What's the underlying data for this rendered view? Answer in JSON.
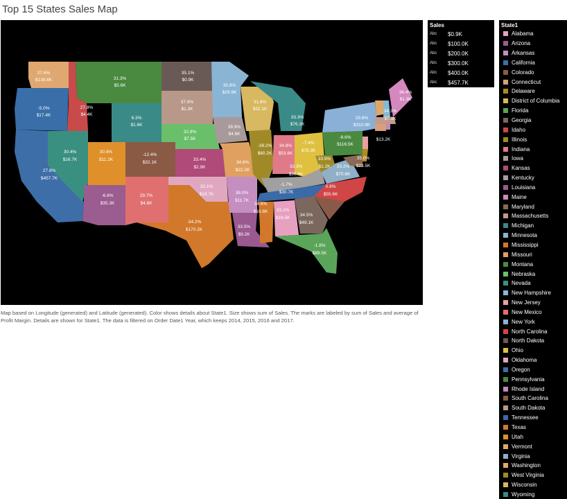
{
  "title": "Top 15 States Sales Map",
  "caption": "Map based on Longitude (generated) and Latitude (generated).  Color shows details about State1.  Size shows sum of Sales.  The marks are labeled by sum of Sales and average of Profit Margin.  Details are shown for State1. The data is filtered on Order Date1 Year, which keeps 2014, 2015, 2016 and 2017.",
  "sales_legend": {
    "header": "Sales",
    "items": [
      "$0.9K",
      "$100.0K",
      "$200.0K",
      "$300.0K",
      "$400.0K",
      "$457.7K"
    ],
    "icon_text": "Abc"
  },
  "state_legend": {
    "header": "State1",
    "items": [
      {
        "name": "Alabama",
        "color": "#e8a0c0"
      },
      {
        "name": "Arizona",
        "color": "#9b5c8f"
      },
      {
        "name": "Arkansas",
        "color": "#c48ec1"
      },
      {
        "name": "California",
        "color": "#3e6ea8"
      },
      {
        "name": "Colorado",
        "color": "#8a5a45"
      },
      {
        "name": "Connecticut",
        "color": "#d6a07a"
      },
      {
        "name": "Delaware",
        "color": "#b08a20"
      },
      {
        "name": "District of Columbia",
        "color": "#d7b75a"
      },
      {
        "name": "Florida",
        "color": "#5ba55a"
      },
      {
        "name": "Georgia",
        "color": "#7b675d"
      },
      {
        "name": "Idaho",
        "color": "#c84a4a"
      },
      {
        "name": "Illinois",
        "color": "#a08a2a"
      },
      {
        "name": "Indiana",
        "color": "#e07a88"
      },
      {
        "name": "Iowa",
        "color": "#a89a9a"
      },
      {
        "name": "Kansas",
        "color": "#b04a78"
      },
      {
        "name": "Kentucky",
        "color": "#a0a0a0"
      },
      {
        "name": "Louisiana",
        "color": "#9a5a90"
      },
      {
        "name": "Maine",
        "color": "#d488be"
      },
      {
        "name": "Maryland",
        "color": "#8a6a55"
      },
      {
        "name": "Massachusetts",
        "color": "#c49a8a"
      },
      {
        "name": "Michigan",
        "color": "#3a8a88"
      },
      {
        "name": "Minnesota",
        "color": "#8ab4d4"
      },
      {
        "name": "Mississippi",
        "color": "#d2782a"
      },
      {
        "name": "Missouri",
        "color": "#e0a060"
      },
      {
        "name": "Montana",
        "color": "#4a8a40"
      },
      {
        "name": "Nebraska",
        "color": "#6abf6a"
      },
      {
        "name": "Nevada",
        "color": "#3a9080"
      },
      {
        "name": "New Hampshire",
        "color": "#88b8d8"
      },
      {
        "name": "New Jersey",
        "color": "#e8a0a0"
      },
      {
        "name": "New Mexico",
        "color": "#e07070"
      },
      {
        "name": "New York",
        "color": "#8ab0d8"
      },
      {
        "name": "North Carolina",
        "color": "#d04545"
      },
      {
        "name": "North Dakota",
        "color": "#6a5a55"
      },
      {
        "name": "Ohio",
        "color": "#e0c040"
      },
      {
        "name": "Oklahoma",
        "color": "#e0a8c0"
      },
      {
        "name": "Oregon",
        "color": "#3a6ea8"
      },
      {
        "name": "Pennsylvania",
        "color": "#4a8a40"
      },
      {
        "name": "Rhode Island",
        "color": "#c08ac0"
      },
      {
        "name": "South Carolina",
        "color": "#8a5a48"
      },
      {
        "name": "South Dakota",
        "color": "#b89888"
      },
      {
        "name": "Tennessee",
        "color": "#3a6aa8"
      },
      {
        "name": "Texas",
        "color": "#d2782a"
      },
      {
        "name": "Utah",
        "color": "#e0902a"
      },
      {
        "name": "Vermont",
        "color": "#e0a868"
      },
      {
        "name": "Virginia",
        "color": "#90b0c8"
      },
      {
        "name": "Washington",
        "color": "#e0a870"
      },
      {
        "name": "West Virginia",
        "color": "#a08a28"
      },
      {
        "name": "Wisconsin",
        "color": "#d8b860"
      },
      {
        "name": "Wyoming",
        "color": "#3a8a88"
      }
    ]
  },
  "map_labels": [
    {
      "state": "Washington",
      "margin": "27.6%",
      "sales": "$138.6K"
    },
    {
      "state": "Montana",
      "margin": "31.3%",
      "sales": "$5.6K"
    },
    {
      "state": "North Dakota",
      "margin": "35.1%",
      "sales": "$0.9K"
    },
    {
      "state": "Minnesota",
      "margin": "35.8%",
      "sales": "$29.9K"
    },
    {
      "state": "Oregon",
      "margin": "-5.0%",
      "sales": "$17.4K"
    },
    {
      "state": "Idaho",
      "margin": "27.8%",
      "sales": "$4.4K"
    },
    {
      "state": "Wyoming",
      "margin": "6.3%",
      "sales": "$1.6K"
    },
    {
      "state": "South Dakota",
      "margin": "37.8%",
      "sales": "$1.3K"
    },
    {
      "state": "Wisconsin",
      "margin": "31.8%",
      "sales": "$32.1K"
    },
    {
      "state": "Michigan",
      "margin": "33.3%",
      "sales": "$76.3K"
    },
    {
      "state": "New York",
      "margin": "29.8%",
      "sales": "$310.9K"
    },
    {
      "state": "Maine",
      "margin": "36.4%",
      "sales": "$1.3K"
    },
    {
      "state": "Vermont",
      "margin": "34.3%",
      "sales": "$7.3K"
    },
    {
      "state": "Nebraska",
      "margin": "32.8%",
      "sales": "$7.5K"
    },
    {
      "state": "Iowa",
      "margin": "39.9%",
      "sales": "$4.6K"
    },
    {
      "state": "Pennsylvania",
      "margin": "-8.6%",
      "sales": "$116.5K"
    },
    {
      "state": "Nevada",
      "margin": "30.4%",
      "sales": "$16.7K"
    },
    {
      "state": "Utah",
      "margin": "30.9%",
      "sales": "$11.2K"
    },
    {
      "state": "Colorado",
      "margin": "-12.4%",
      "sales": "$32.1K"
    },
    {
      "state": "Illinois",
      "margin": "-39.2%",
      "sales": "$80.2K"
    },
    {
      "state": "Indiana",
      "margin": "34.8%",
      "sales": "$53.6K"
    },
    {
      "state": "Ohio",
      "margin": "-7.4%",
      "sales": "$78.3K"
    },
    {
      "state": "Rhode Island",
      "margin": "",
      "sales": "$13.2K"
    },
    {
      "state": "California",
      "margin": "27.8%",
      "sales": "$457.7K"
    },
    {
      "state": "Kansas",
      "margin": "33.4%",
      "sales": "$2.9K"
    },
    {
      "state": "Missouri",
      "margin": "34.6%",
      "sales": "$22.2K"
    },
    {
      "state": "Kentucky",
      "margin": "33.3%",
      "sales": "$36.6K"
    },
    {
      "state": "West Virginia",
      "margin": "33.9%",
      "sales": "$1.2K"
    },
    {
      "state": "Virginia",
      "margin": "33.2%",
      "sales": "$70.6K"
    },
    {
      "state": "Maryland",
      "margin": "35.0%",
      "sales": "$23.5K"
    },
    {
      "state": "Oklahoma",
      "margin": "33.1%",
      "sales": "$19.7K"
    },
    {
      "state": "Tennessee",
      "margin": "-1.7%",
      "sales": "$30.7K"
    },
    {
      "state": "North Carolina",
      "margin": "0.8%",
      "sales": "$55.6K"
    },
    {
      "state": "Arizona",
      "margin": "-6.6%",
      "sales": "$35.3K"
    },
    {
      "state": "New Mexico",
      "margin": "29.7%",
      "sales": "$4.8K"
    },
    {
      "state": "Arkansas",
      "margin": "38.0%",
      "sales": "$11.7K"
    },
    {
      "state": "Mississippi",
      "margin": "34.6%",
      "sales": "$10.8K"
    },
    {
      "state": "Alabama",
      "margin": "33.1%",
      "sales": "$19.5K"
    },
    {
      "state": "Georgia",
      "margin": "34.5%",
      "sales": "$49.1K"
    },
    {
      "state": "Texas",
      "margin": "-34.2%",
      "sales": "$170.2K"
    },
    {
      "state": "Louisiana",
      "margin": "33.5%",
      "sales": "$9.2K"
    },
    {
      "state": "Florida",
      "margin": "-1.8%",
      "sales": "$89.5K"
    }
  ]
}
